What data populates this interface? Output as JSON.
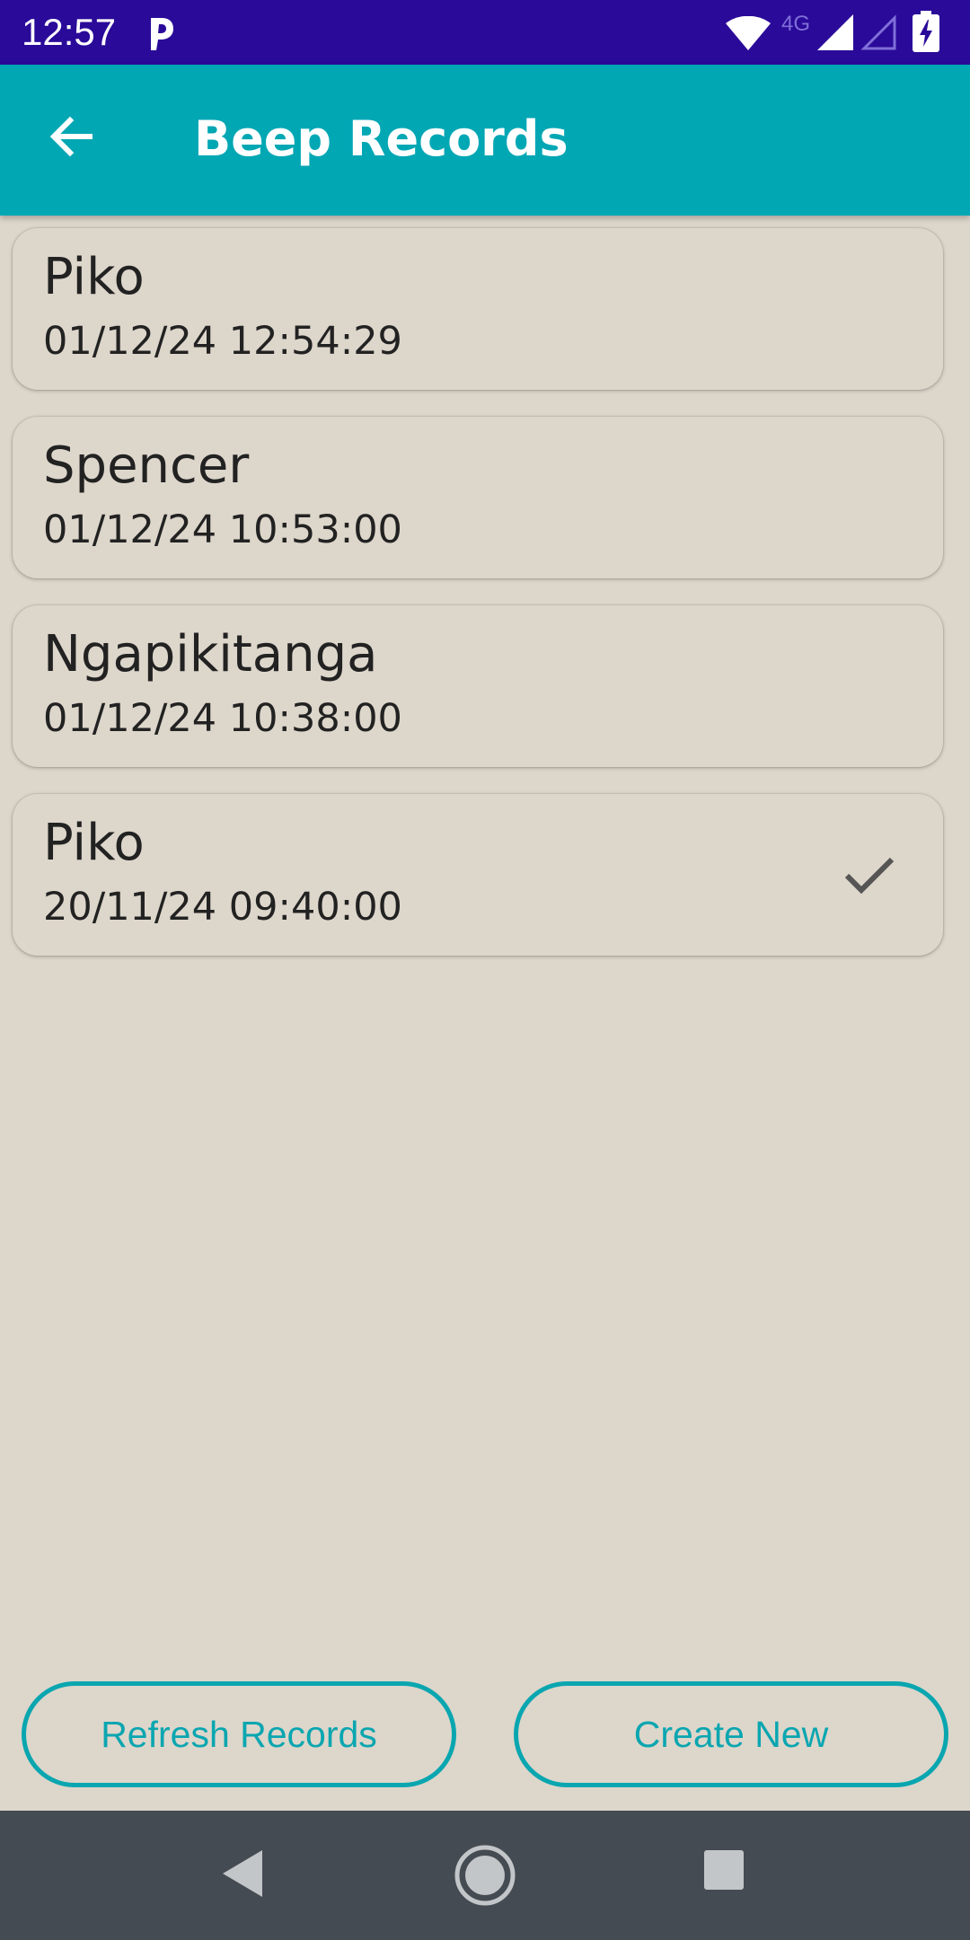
{
  "status_bar": {
    "time": "12:57",
    "network": "4G",
    "icons": [
      "parking-app-icon",
      "wifi-icon",
      "signal-icon",
      "signal-empty-icon",
      "battery-charging-icon"
    ]
  },
  "app_bar": {
    "title": "Beep Records",
    "back_icon": "arrow-left-icon",
    "color": "#02a7b4"
  },
  "records": [
    {
      "name": "Piko",
      "timestamp": "01/12/24 12:54:29",
      "checked": false
    },
    {
      "name": "Spencer",
      "timestamp": "01/12/24 10:53:00",
      "checked": false
    },
    {
      "name": "Ngapikitanga",
      "timestamp": "01/12/24 10:38:00",
      "checked": false
    },
    {
      "name": "Piko",
      "timestamp": "20/11/24 09:40:00",
      "checked": true
    }
  ],
  "actions": {
    "refresh_label": "Refresh Records",
    "create_label": "Create New",
    "accent_color": "#0aa6b0"
  },
  "nav_bar": {
    "icons": [
      "nav-back-icon",
      "nav-home-icon",
      "nav-recents-icon"
    ]
  },
  "colors": {
    "status_bar": "#2a0a99",
    "background": "#ddd6cb",
    "nav_bar": "#454b52"
  }
}
